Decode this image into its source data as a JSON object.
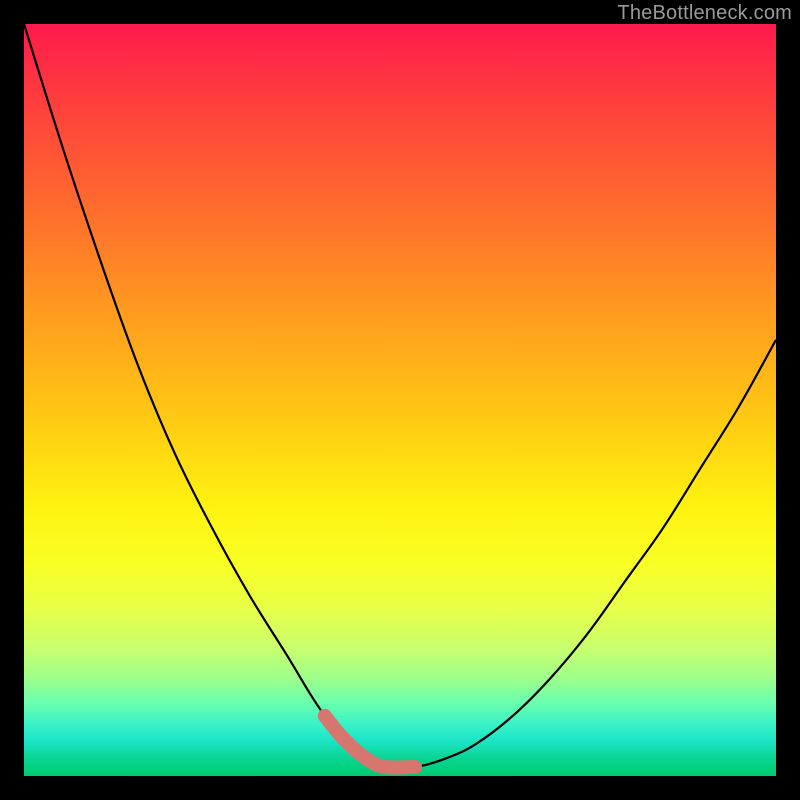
{
  "watermark": {
    "text": "TheBottleneck.com"
  },
  "colors": {
    "frame": "#000000",
    "curve_stroke": "#000000",
    "highlight_stroke": "#d7766f"
  },
  "chart_data": {
    "type": "line",
    "title": "",
    "xlabel": "",
    "ylabel": "",
    "xlim": [
      0,
      100
    ],
    "ylim": [
      0,
      100
    ],
    "grid": false,
    "legend": false,
    "series": [
      {
        "name": "bottleneck-curve",
        "x": [
          0,
          5,
          10,
          15,
          20,
          25,
          30,
          35,
          38,
          40,
          42,
          44,
          46,
          48,
          52,
          56,
          60,
          65,
          70,
          75,
          80,
          85,
          90,
          95,
          100
        ],
        "y": [
          100,
          84,
          69,
          55,
          43,
          33,
          24,
          16,
          11,
          8,
          5.5,
          3.5,
          2,
          1.2,
          1.2,
          2.3,
          4.2,
          8,
          13,
          19,
          26,
          33,
          41,
          49,
          58
        ]
      }
    ],
    "highlight_range_x": [
      40,
      54
    ],
    "annotations": []
  }
}
